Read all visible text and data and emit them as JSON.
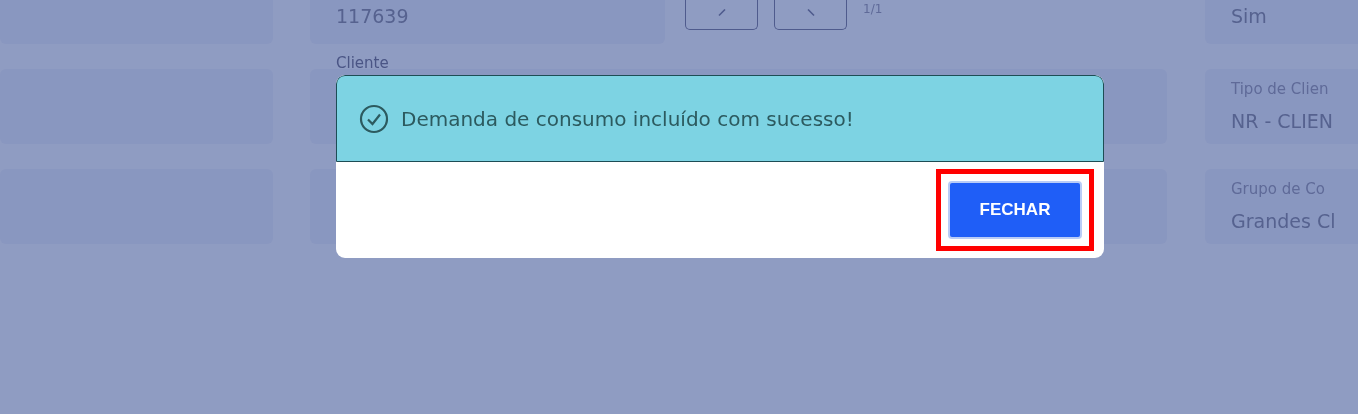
{
  "background_form": {
    "code_field": {
      "value": "117639"
    },
    "pager": {
      "text": "1/1"
    },
    "client_field": {
      "label": "Cliente"
    },
    "right_fields": [
      {
        "value": "Sim"
      },
      {
        "label": "Tipo de Clien",
        "value": "NR - CLIEN"
      },
      {
        "label": "Grupo de Co",
        "value": "Grandes Cl"
      }
    ]
  },
  "dialog": {
    "message": "Demanda de consumo incluído com sucesso!",
    "button": {
      "label": "FECHAR",
      "highlighted": true
    }
  }
}
